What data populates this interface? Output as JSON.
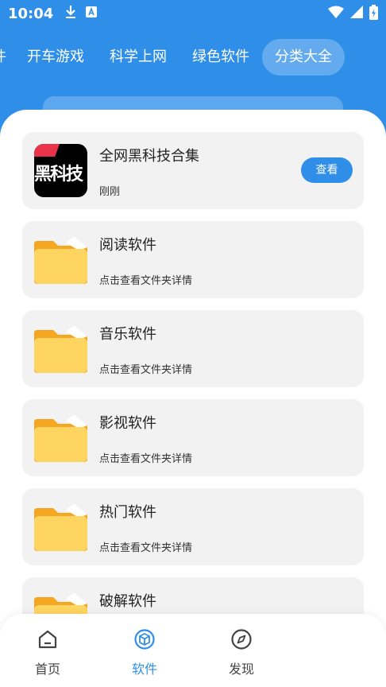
{
  "status_bar": {
    "time": "10:04",
    "icons": [
      "download-icon",
      "notification-a-icon",
      "wifi-icon",
      "signal-icon",
      "battery-charging-icon"
    ]
  },
  "tabs": [
    {
      "label": "件",
      "active": false
    },
    {
      "label": "开车游戏",
      "active": false
    },
    {
      "label": "科学上网",
      "active": false
    },
    {
      "label": "绿色软件",
      "active": false
    },
    {
      "label": "分类大全",
      "active": true
    }
  ],
  "list": {
    "featured": {
      "title": "全网黑科技合集",
      "subtitle": "刚刚",
      "thumb_text": "黑科技",
      "button_label": "查看"
    },
    "folders": [
      {
        "title": "阅读软件",
        "subtitle": "点击查看文件夹详情"
      },
      {
        "title": "音乐软件",
        "subtitle": "点击查看文件夹详情"
      },
      {
        "title": "影视软件",
        "subtitle": "点击查看文件夹详情"
      },
      {
        "title": "热门软件",
        "subtitle": "点击查看文件夹详情"
      },
      {
        "title": "破解软件",
        "subtitle": ""
      }
    ]
  },
  "bottom_nav": {
    "items": [
      {
        "label": "首页",
        "icon": "home-icon",
        "active": false
      },
      {
        "label": "软件",
        "icon": "cube-icon",
        "active": true
      },
      {
        "label": "发现",
        "icon": "compass-icon",
        "active": false
      }
    ]
  },
  "colors": {
    "primary": "#2f8fe8",
    "folder": "#ffd561",
    "folder_tab": "#f5a623"
  }
}
